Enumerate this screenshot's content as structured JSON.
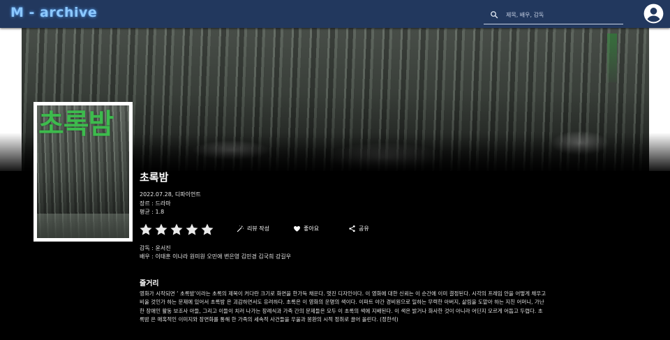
{
  "header": {
    "logo": "M - archive",
    "search_placeholder": "제목, 배우, 감독"
  },
  "movie": {
    "title": "초록밤",
    "poster_title": "초록밤",
    "date_distributor": "2022.07.28, 디파이언트",
    "genre": "장르 : 드라마",
    "average": "평균 : 1.8",
    "rating": 0,
    "stars_total": 5
  },
  "actions": {
    "review": "리뷰 작성",
    "like": "좋아요",
    "share": "공유"
  },
  "credits": {
    "director": "감독 : 윤서진",
    "cast": "배우 : 이태훈 이나라 원미원 오민애 변은영 김민경 김국희 강길우"
  },
  "synopsis": {
    "heading": "줄거리",
    "text": "영화가 시작되면 ‘ 초록밤’이라는 초록의 제목이 커다란 크기로 화면을 한가득 채운다. 멋진 디자인이다. 이 영화에 대한 신뢰는 이 순간에 이미 결정된다. 시각의 프레임 안을 어떻게 채우고 비울 것인가 하는 문제에 있어서 초록밤 은 괴감하면서도 유려하다. 초록은 이 영화의 운명의 색이다. 이파트 야간 경비원으로 일하는 무력한 아버지, 삶림을 도맡아 하는 지친 어머니, 가난한 장애인 활동 보조사 아들, 그리고 이들이 치러 나가는 장례식과 가족 간의 문제들은 모두 이 초록의 색에 지배된다. 이 색은 밝거나 화사한 것이 아니라 어딘지 모르게 어둡고 두렵다. 초록밤 은 매혹적인 이미지와 장면화를 통해 한 가족의 세속적 사건들을 우울과 몽환의 시적 정취로 끌어 올린다. (정한석)"
  },
  "colors": {
    "topbar": "#22385e",
    "logo": "#8cc8ff",
    "star_empty": "#e9e9e9",
    "poster_green": "#3dbb4d"
  }
}
